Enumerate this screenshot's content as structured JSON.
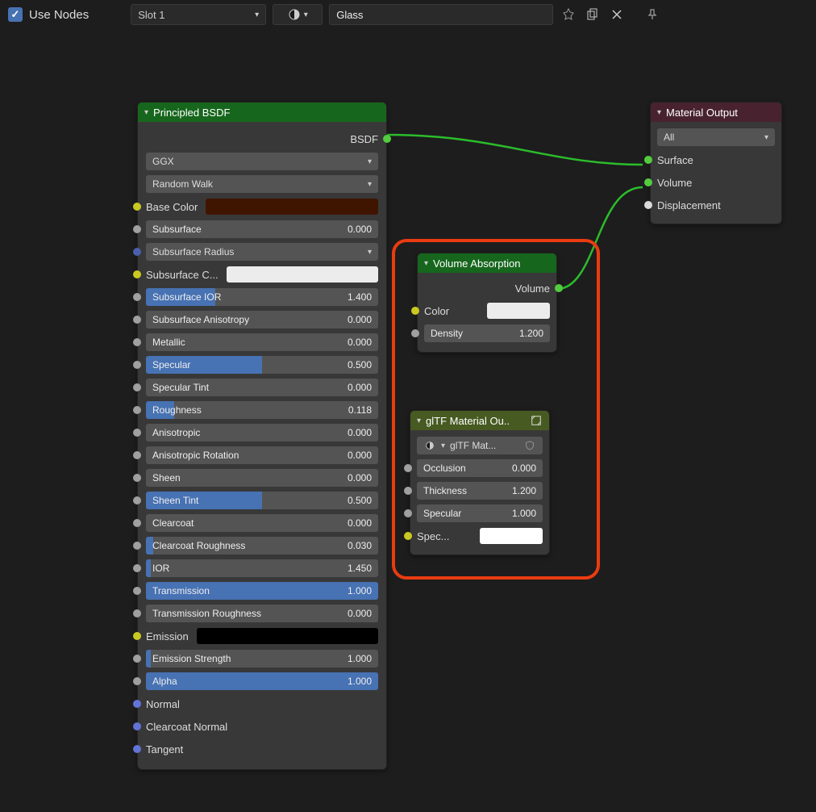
{
  "toolbar": {
    "use_nodes_checked": true,
    "use_nodes_label": "Use Nodes",
    "slot": "Slot 1",
    "material_name": "Glass"
  },
  "principled": {
    "title": "Principled BSDF",
    "output": "BSDF",
    "distribution": "GGX",
    "subsurface_method": "Random Walk",
    "rows": [
      {
        "kind": "colorlabel",
        "sock": "yellow",
        "label": "Base Color",
        "color": "#401500"
      },
      {
        "kind": "num",
        "sock": "grey",
        "label": "Subsurface",
        "val": "0.000",
        "fill": 0
      },
      {
        "kind": "select",
        "sock": "darkblue",
        "label": "Subsurface Radius"
      },
      {
        "kind": "colorlabel",
        "sock": "yellow",
        "label": "Subsurface C...",
        "color": "#ececec"
      },
      {
        "kind": "num",
        "sock": "grey",
        "label": "Subsurface IOR",
        "val": "1.400",
        "fill": 30
      },
      {
        "kind": "num",
        "sock": "grey",
        "label": "Subsurface Anisotropy",
        "val": "0.000",
        "fill": 0
      },
      {
        "kind": "num",
        "sock": "grey",
        "label": "Metallic",
        "val": "0.000",
        "fill": 0
      },
      {
        "kind": "num",
        "sock": "grey",
        "label": "Specular",
        "val": "0.500",
        "fill": 50
      },
      {
        "kind": "num",
        "sock": "grey",
        "label": "Specular Tint",
        "val": "0.000",
        "fill": 0
      },
      {
        "kind": "num",
        "sock": "grey",
        "label": "Roughness",
        "val": "0.118",
        "fill": 12
      },
      {
        "kind": "num",
        "sock": "grey",
        "label": "Anisotropic",
        "val": "0.000",
        "fill": 0
      },
      {
        "kind": "num",
        "sock": "grey",
        "label": "Anisotropic Rotation",
        "val": "0.000",
        "fill": 0
      },
      {
        "kind": "num",
        "sock": "grey",
        "label": "Sheen",
        "val": "0.000",
        "fill": 0
      },
      {
        "kind": "num",
        "sock": "grey",
        "label": "Sheen Tint",
        "val": "0.500",
        "fill": 50
      },
      {
        "kind": "num",
        "sock": "grey",
        "label": "Clearcoat",
        "val": "0.000",
        "fill": 0
      },
      {
        "kind": "num",
        "sock": "grey",
        "label": "Clearcoat Roughness",
        "val": "0.030",
        "fill": 3
      },
      {
        "kind": "num",
        "sock": "grey",
        "label": "IOR",
        "val": "1.450",
        "fill": 2
      },
      {
        "kind": "num",
        "sock": "grey",
        "label": "Transmission",
        "val": "1.000",
        "fill": 100
      },
      {
        "kind": "num",
        "sock": "grey",
        "label": "Transmission Roughness",
        "val": "0.000",
        "fill": 0
      },
      {
        "kind": "colorlabel",
        "sock": "yellow",
        "label": "Emission",
        "color": "#000000"
      },
      {
        "kind": "num",
        "sock": "grey",
        "label": "Emission Strength",
        "val": "1.000",
        "fill": 2
      },
      {
        "kind": "num",
        "sock": "grey",
        "label": "Alpha",
        "val": "1.000",
        "fill": 100
      },
      {
        "kind": "plain",
        "sock": "blue",
        "label": "Normal"
      },
      {
        "kind": "plain",
        "sock": "blue",
        "label": "Clearcoat Normal"
      },
      {
        "kind": "plain",
        "sock": "blue",
        "label": "Tangent"
      }
    ]
  },
  "volume": {
    "title": "Volume Absorption",
    "output": "Volume",
    "color_label": "Color",
    "color_swatch": "#ececec",
    "density_label": "Density",
    "density_val": "1.200"
  },
  "gltf": {
    "title": "glTF Material Ou..",
    "browse": "glTF Mat...",
    "rows": [
      {
        "label": "Occlusion",
        "val": "0.000"
      },
      {
        "label": "Thickness",
        "val": "1.200"
      },
      {
        "label": "Specular",
        "val": "1.000"
      }
    ],
    "spec_color_label": "Spec...",
    "spec_color": "#ffffff"
  },
  "output": {
    "title": "Material Output",
    "target": "All",
    "surface": "Surface",
    "volume": "Volume",
    "displacement": "Displacement"
  }
}
